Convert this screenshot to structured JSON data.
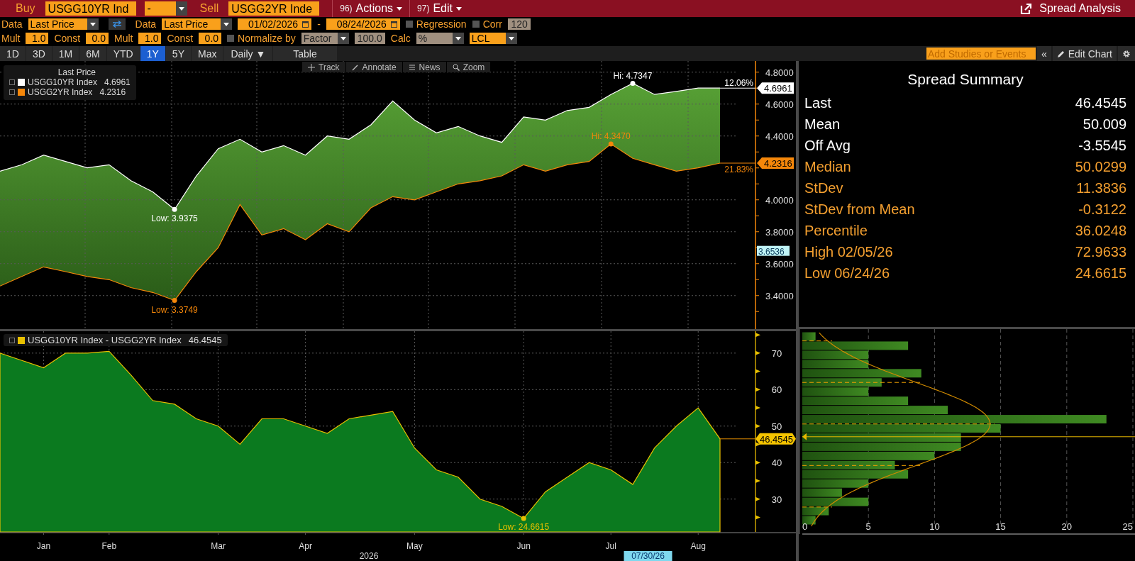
{
  "header": {
    "buy_label": "Buy",
    "buy_ticker": "USGG10YR Ind",
    "buy_option": "-",
    "sell_label": "Sell",
    "sell_ticker": "USGG2YR Inde",
    "menus": [
      {
        "number": "96)",
        "label": "Actions"
      },
      {
        "number": "97)",
        "label": "Edit"
      }
    ],
    "title": "Spread Analysis"
  },
  "settings": {
    "rows": [
      {
        "items": [
          {
            "kind": "label",
            "text": "Data"
          },
          {
            "kind": "dropdown",
            "value": "Last Price",
            "disabled": false
          },
          {
            "kind": "swap"
          },
          {
            "kind": "label",
            "text": "Data"
          },
          {
            "kind": "dropdown",
            "value": "Last Price",
            "disabled": false
          },
          {
            "kind": "date",
            "value": "01/02/2026"
          },
          {
            "kind": "label",
            "text": "-"
          },
          {
            "kind": "date",
            "value": "08/24/2026"
          },
          {
            "kind": "checkbox",
            "text": "Regression",
            "checked": false
          },
          {
            "kind": "checkbox",
            "text": "Corr",
            "checked": false
          },
          {
            "kind": "field",
            "value": "120",
            "disabled": true
          }
        ]
      },
      {
        "items": [
          {
            "kind": "label",
            "text": "Mult"
          },
          {
            "kind": "field",
            "value": "1.0",
            "disabled": false
          },
          {
            "kind": "label",
            "text": "Const"
          },
          {
            "kind": "field",
            "value": "0.0",
            "disabled": false
          },
          {
            "kind": "label",
            "text": "Mult"
          },
          {
            "kind": "field",
            "value": "1.0",
            "disabled": false
          },
          {
            "kind": "label",
            "text": "Const"
          },
          {
            "kind": "field",
            "value": "0.0",
            "disabled": false
          },
          {
            "kind": "checkbox",
            "text": "Normalize by",
            "checked": false
          },
          {
            "kind": "dropdown",
            "value": "Factor",
            "disabled": true
          },
          {
            "kind": "field",
            "value": "100.0",
            "disabled": true
          },
          {
            "kind": "label",
            "text": "Calc"
          },
          {
            "kind": "dropdown",
            "value": "%",
            "disabled": true
          },
          {
            "kind": "dropdown",
            "value": "LCL",
            "disabled": false
          }
        ]
      }
    ]
  },
  "range_bar": {
    "periods": [
      {
        "label": "1D",
        "selected": false
      },
      {
        "label": "3D",
        "selected": false
      },
      {
        "label": "1M",
        "selected": false
      },
      {
        "label": "6M",
        "selected": false
      },
      {
        "label": "YTD",
        "selected": false
      },
      {
        "label": "1Y",
        "selected": true
      },
      {
        "label": "5Y",
        "selected": false
      },
      {
        "label": "Max",
        "selected": false
      }
    ],
    "frequency": "Daily ▼",
    "table_button": "Table",
    "studies_placeholder": "Add Studies or Events",
    "collapse_button": "«",
    "edit_chart_button": "Edit Chart"
  },
  "chart_toolbar": [
    "Track",
    "Annotate",
    "News",
    "Zoom"
  ],
  "price_chart": {
    "legend_title": "Last Price",
    "legend_values": [
      "4.6961",
      "4.2316"
    ],
    "series_labels": [
      {
        "high": "Hi: 4.7347",
        "low": "Low: 3.9375",
        "change": "12.06%",
        "last": "4.6961"
      },
      {
        "high": "Hi: 4.3470",
        "low": "Low: 3.3749",
        "change": "21.83%",
        "last": "4.2316"
      }
    ],
    "cursor_value": "3.6536",
    "chart_data": {
      "type": "line",
      "categories": [
        null,
        null,
        null,
        null,
        null,
        null,
        null,
        null,
        null,
        null,
        null,
        null,
        null,
        null,
        null,
        null,
        null,
        null,
        null,
        null,
        null,
        null,
        null,
        null,
        null,
        null,
        null,
        null,
        null,
        null,
        null,
        null,
        null,
        null
      ],
      "ylim": [
        3.19,
        4.87
      ],
      "grid": true,
      "legend": true,
      "yticks": [
        {
          "value": 3.4,
          "label": "3.4000"
        },
        {
          "value": 3.6,
          "label": "3.6000"
        },
        {
          "value": 3.8,
          "label": "3.8000"
        },
        {
          "value": 4.0,
          "label": "4.0000"
        },
        {
          "value": 4.4,
          "label": "4.4000"
        },
        {
          "value": 4.6,
          "label": "4.6000"
        },
        {
          "value": 4.8,
          "label": "4.8000"
        }
      ],
      "series": [
        {
          "name": "USGG10YR Index",
          "color": "#ffffff",
          "values": [
            4.18,
            4.22,
            4.28,
            4.24,
            4.2,
            4.22,
            4.12,
            4.05,
            3.94,
            4.15,
            4.32,
            4.38,
            4.3,
            4.34,
            4.28,
            4.4,
            4.38,
            4.47,
            4.62,
            4.5,
            4.42,
            4.46,
            4.4,
            4.36,
            4.52,
            4.5,
            4.56,
            4.58,
            4.66,
            4.73,
            4.66,
            4.68,
            4.7,
            4.7
          ]
        },
        {
          "name": "USGG2YR Index",
          "color": "#f5870a",
          "values": [
            3.46,
            3.52,
            3.58,
            3.55,
            3.52,
            3.5,
            3.45,
            3.42,
            3.37,
            3.55,
            3.7,
            3.97,
            3.78,
            3.82,
            3.75,
            3.85,
            3.8,
            3.95,
            4.02,
            4.0,
            4.05,
            4.1,
            4.12,
            4.15,
            4.22,
            4.18,
            4.22,
            4.24,
            4.35,
            4.26,
            4.22,
            4.18,
            4.2,
            4.23
          ]
        }
      ]
    }
  },
  "spread_chart": {
    "legend": {
      "value": "46.4545",
      "color": "#e8c000"
    },
    "labels": {
      "low": "Low: 24.6615",
      "last": "46.4545",
      "cursor_date": "07/30/26"
    },
    "chart_data": {
      "type": "area",
      "categories": [
        null,
        null,
        "Jan",
        null,
        null,
        "Feb",
        null,
        null,
        null,
        null,
        "Mar",
        null,
        null,
        null,
        "Apr",
        null,
        null,
        null,
        null,
        "May",
        null,
        null,
        null,
        null,
        "Jun",
        null,
        null,
        null,
        "Jul",
        null,
        null,
        null,
        "Aug",
        null
      ],
      "ylim": [
        21,
        76
      ],
      "grid": true,
      "legend": true,
      "yticks": [
        30,
        40,
        50,
        60,
        70
      ],
      "xlabel": "2026",
      "series": [
        {
          "name": "USGG10YR Index - USGG2YR Index",
          "color": "#0b7a1f",
          "values": [
            70,
            68,
            66,
            70,
            70,
            70.5,
            64,
            57,
            56,
            52,
            50,
            45,
            52,
            52,
            50,
            48,
            52,
            53,
            54,
            44,
            38,
            36,
            30,
            28,
            24.7,
            32,
            36,
            40,
            38,
            34,
            44,
            50,
            55,
            46.5
          ]
        }
      ]
    }
  },
  "summary": {
    "title": "Spread Summary",
    "rows": [
      {
        "label": "Last",
        "value": "46.4545",
        "color": "#ffffff"
      },
      {
        "label": "Mean",
        "value": "50.009",
        "color": "#ffffff"
      },
      {
        "label": "Off Avg",
        "value": "-3.5545",
        "color": "#ffffff"
      },
      {
        "label": "Median",
        "value": "50.0299",
        "color": "#f5a030"
      },
      {
        "label": "StDev",
        "value": "11.3836",
        "color": "#f5a030"
      },
      {
        "label": "StDev from Mean",
        "value": "-0.3122",
        "color": "#f5a030"
      },
      {
        "label": "Percentile",
        "value": "36.0248",
        "color": "#f5a030"
      },
      {
        "label": "High 02/05/26",
        "value": "72.9633",
        "color": "#f5a030"
      },
      {
        "label": "Low 06/24/26",
        "value": "24.6615",
        "color": "#f5a030"
      }
    ]
  },
  "histogram": {
    "chart_data": {
      "type": "bar",
      "orientation": "horizontal",
      "categories": [
        null,
        null,
        null,
        null,
        null,
        null,
        null,
        null,
        null,
        null,
        null,
        null,
        null,
        null,
        null,
        null,
        null,
        null,
        null,
        null,
        null
      ],
      "values": [
        1,
        8,
        5,
        5,
        9,
        6,
        5,
        8,
        11,
        23,
        15,
        12,
        12,
        10,
        7,
        8,
        5,
        3,
        5,
        2,
        1
      ],
      "xlim": [
        0,
        25
      ],
      "xticks": [
        0,
        5,
        10,
        15,
        20,
        25
      ],
      "grid": true
    }
  }
}
